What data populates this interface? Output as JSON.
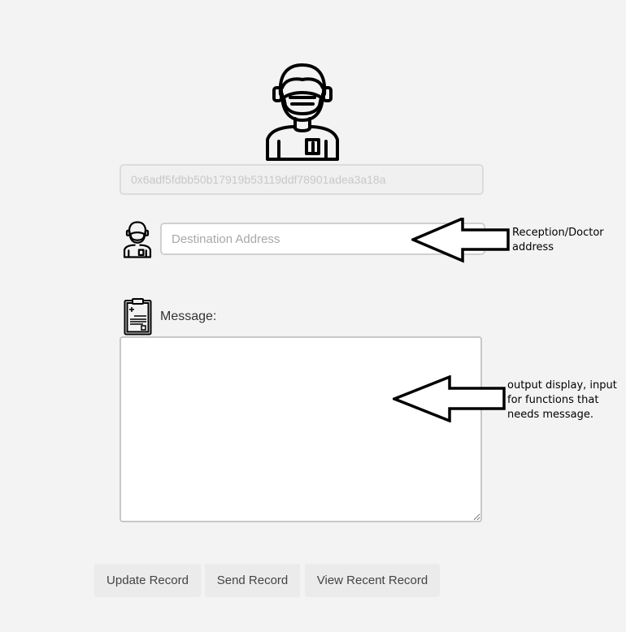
{
  "account": {
    "address": "0x6adf5fdbb50b17919b53119ddf78901adea3a18a"
  },
  "destination": {
    "placeholder": "Destination Address",
    "value": ""
  },
  "message": {
    "label": "Message:",
    "value": ""
  },
  "annotations": {
    "destination_note": "Reception/Doctor address",
    "message_note": "output display, input for functions that needs message."
  },
  "buttons": {
    "update": "Update Record",
    "send": "Send Record",
    "view": "View Recent Record"
  },
  "icons": {
    "avatar": "masked-doctor-icon",
    "record": "clipboard-icon",
    "arrow": "left-arrow-icon"
  }
}
